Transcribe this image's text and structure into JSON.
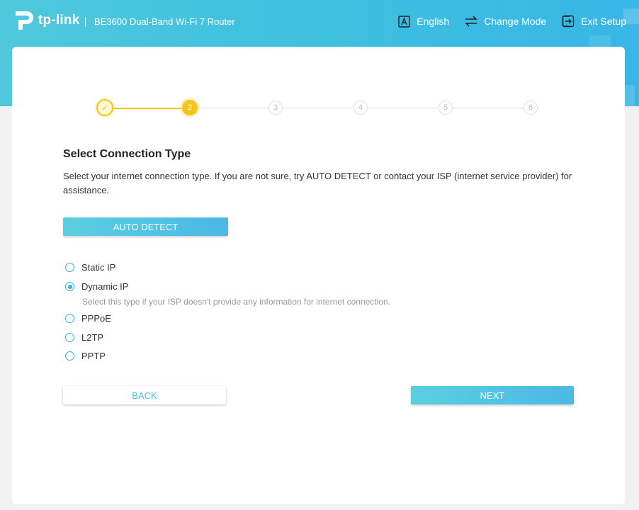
{
  "header": {
    "brand": "tp-link",
    "product": "BE3600 Dual-Band Wi-Fi 7 Router",
    "actions": [
      {
        "label": "English",
        "icon": "language-icon"
      },
      {
        "label": "Change Mode",
        "icon": "change-mode-icon"
      },
      {
        "label": "Exit Setup",
        "icon": "exit-icon"
      }
    ]
  },
  "stepper": {
    "steps": [
      {
        "label": "✓",
        "state": "done"
      },
      {
        "label": "2",
        "state": "active"
      },
      {
        "label": "3",
        "state": "pending"
      },
      {
        "label": "4",
        "state": "pending"
      },
      {
        "label": "5",
        "state": "pending"
      },
      {
        "label": "6",
        "state": "pending"
      }
    ]
  },
  "main": {
    "title": "Select Connection Type",
    "description": "Select your internet connection type. If you are not sure, try AUTO DETECT or contact your ISP (internet service provider) for assistance.",
    "auto_detect_label": "AUTO DETECT",
    "options": [
      {
        "label": "Static IP",
        "checked": false
      },
      {
        "label": "Dynamic IP",
        "checked": true
      },
      {
        "label": "PPPoE",
        "checked": false
      },
      {
        "label": "L2TP",
        "checked": false
      },
      {
        "label": "PPTP",
        "checked": false
      }
    ],
    "dynamic_hint": "Select this type if your ISP doesn't provide any information for internet connection.",
    "back_label": "BACK",
    "next_label": "NEXT"
  },
  "colors": {
    "accent": "#4bbfd9",
    "step_done": "#f5c518",
    "header_start": "#4fc8dc",
    "header_end": "#38b6e6"
  }
}
